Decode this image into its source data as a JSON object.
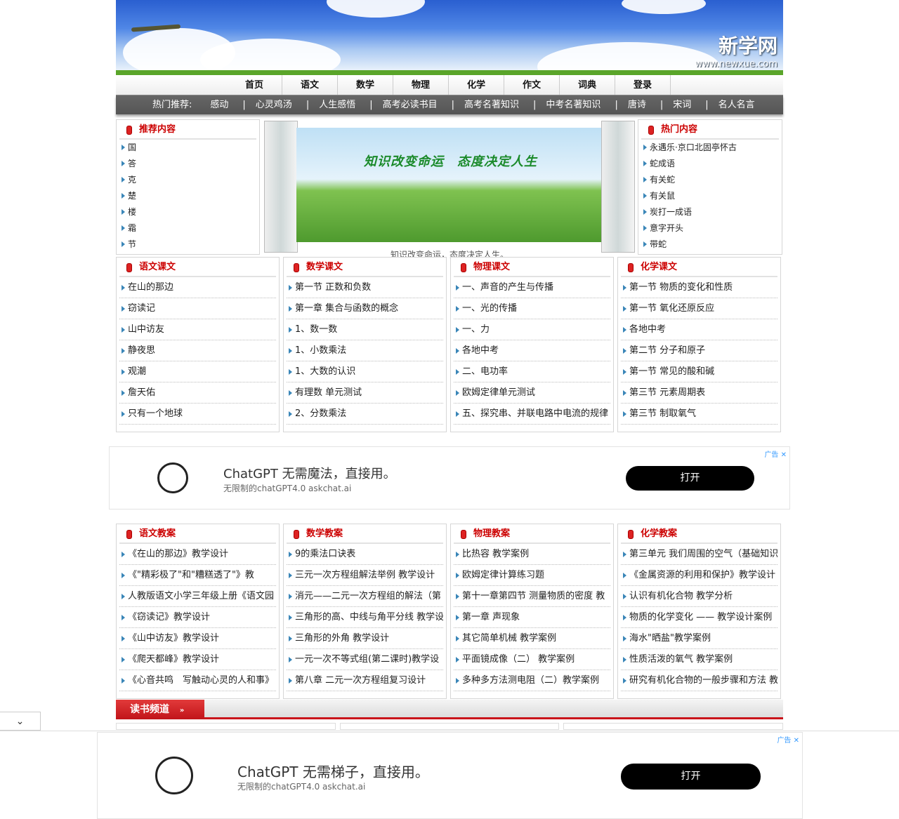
{
  "header": {
    "logo_text": "新学网",
    "logo_url": "www.newxue.com"
  },
  "nav": [
    "首页",
    "语文",
    "数学",
    "物理",
    "化学",
    "作文",
    "词典",
    "登录"
  ],
  "hot": {
    "label": "热门推荐:",
    "items": [
      "感动",
      "心灵鸡汤",
      "人生感悟",
      "高考必读书目",
      "高考名著知识",
      "中考名著知识",
      "唐诗",
      "宋词",
      "名人名言"
    ]
  },
  "recommend": {
    "title": "推荐内容",
    "items": [
      "国",
      "答",
      "克",
      "楚",
      "楼",
      "霜",
      "节"
    ]
  },
  "banner": {
    "slogan": "知识改变命运　态度决定人生",
    "caption": "知识改变命运，态度决定人生。"
  },
  "popular": {
    "title": "热门内容",
    "items": [
      "永遇乐·京口北固亭怀古",
      "蛇成语",
      "有关蛇",
      "有关鼠",
      "炭打一成语",
      "意字开头",
      "带蛇"
    ]
  },
  "courses": [
    {
      "title": "语文课文",
      "items": [
        "在山的那边",
        "窃读记",
        "山中访友",
        "静夜思",
        "观潮",
        "詹天佑",
        "只有一个地球"
      ]
    },
    {
      "title": "数学课文",
      "items": [
        "第一节 正数和负数",
        "第一章 集合与函数的概念",
        "1、数一数",
        "1、小数乘法",
        "1、大数的认识",
        "有理数 单元测试",
        "2、分数乘法"
      ]
    },
    {
      "title": "物理课文",
      "items": [
        "一、声音的产生与传播",
        "一、光的传播",
        "一、力",
        "各地中考",
        "二、电功率",
        "欧姆定律单元测试",
        "五、探究串、并联电路中电流的规律"
      ]
    },
    {
      "title": "化学课文",
      "items": [
        "第一节 物质的变化和性质",
        "第一节 氧化还原反应",
        "各地中考",
        "第二节 分子和原子",
        "第一节 常见的酸和碱",
        "第三节 元素周期表",
        "第三节 制取氧气"
      ]
    }
  ],
  "ad1": {
    "label": "广告",
    "title": "ChatGPT 无需魔法，直接用。",
    "sub": "无限制的chatGPT4.0 askchat.ai",
    "button": "打开"
  },
  "plans": [
    {
      "title": "语文教案",
      "items": [
        "《在山的那边》教学设计",
        "《\"精彩极了\"和\"糟糕透了\"》教",
        "人教版语文小学三年级上册《语文园",
        "《窃读记》教学设计",
        "《山中访友》教学设计",
        "《爬天都峰》教学设计",
        "《心音共鸣　写触动心灵的人和事》"
      ]
    },
    {
      "title": "数学教案",
      "items": [
        "9的乘法口诀表",
        "三元一次方程组解法举例 教学设计",
        "消元——二元一次方程组的解法（第",
        "三角形的高、中线与角平分线 教学设",
        "三角形的外角 教学设计",
        "一元一次不等式组(第二课时)教学设",
        "第八章 二元一次方程组复习设计"
      ]
    },
    {
      "title": "物理教案",
      "items": [
        "比热容 教学案例",
        "欧姆定律计算练习题",
        "第十一章第四节 测量物质的密度 教",
        "第一章 声现象",
        "其它简单机械 教学案例",
        "平面镜成像（二） 教学案例",
        "多种多方法测电阻（二）教学案例"
      ]
    },
    {
      "title": "化学教案",
      "items": [
        "第三单元 我们周围的空气（基础知识",
        "《金属资源的利用和保护》教学设计",
        "认识有机化合物 教学分析",
        "物质的化学变化 —— 教学设计案例",
        "海水\"晒盐\"教学案例",
        "性质活泼的氧气 教学案例",
        "研究有机化合物的一般步骤和方法 教"
      ]
    }
  ],
  "reading": {
    "title": "读书频道",
    "arrow": "»"
  },
  "ad2": {
    "label": "广告",
    "title": "ChatGPT 无需梯子，直接用。",
    "sub": "无限制的chatGPT4.0 askchat.ai",
    "button": "打开"
  },
  "collapse_icon": "⌄"
}
